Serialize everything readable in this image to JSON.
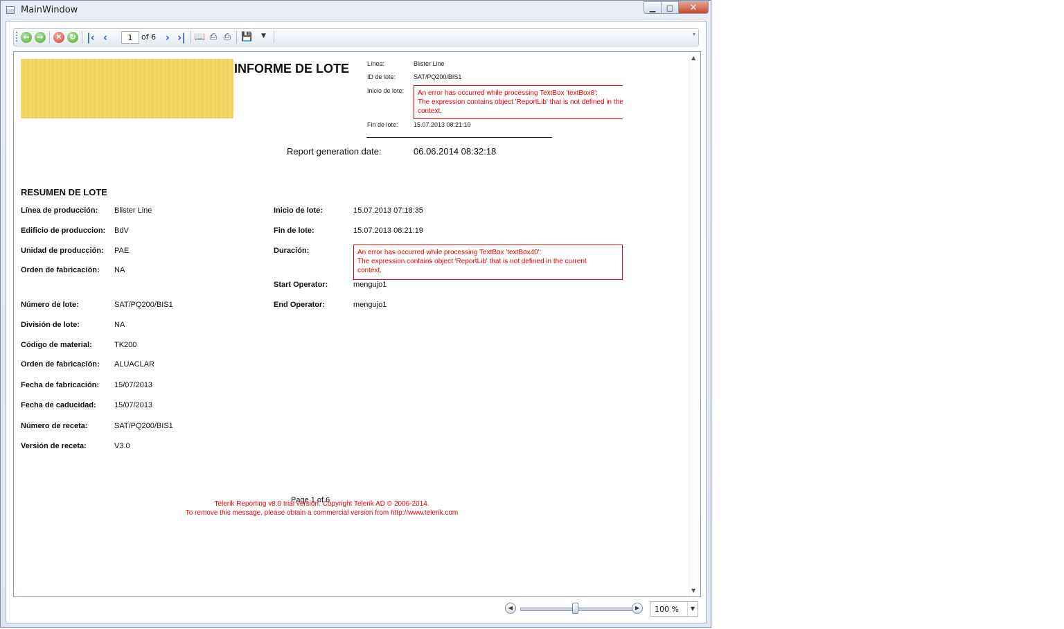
{
  "window": {
    "title": "MainWindow"
  },
  "toolbar": {
    "page_current": "1",
    "page_of": "of 6"
  },
  "report": {
    "title": "INFORME DE LOTE",
    "header": {
      "linea_label": "Línea:",
      "linea_value": "Blister Line",
      "id_label": "ID de lote:",
      "id_value": "SAT/PQ200/BIS1",
      "inicio_label": "Inicio de lote:",
      "inicio_error": [
        "An error has occurred while processing TextBox 'textBox8':",
        "The expression contains object 'ReportLib' that is not defined in the current",
        "context."
      ],
      "fin_label": "Fin de lote:",
      "fin_value": "15.07.2013 08:21:19"
    },
    "generation": {
      "label": "Report generation date:",
      "value": "06.06.2014 08:32:18"
    },
    "summary": {
      "title": "RESUMEN DE LOTE",
      "left_fields": [
        {
          "label": "Línea de producción:",
          "value": "Blister Line"
        },
        {
          "label": "Edificio de produccion:",
          "value": "BdV"
        },
        {
          "label": "Unidad de producción:",
          "value": "PAE"
        },
        {
          "label": "Orden de fabricación:",
          "value": "NA"
        },
        {
          "label": "Número de lote:",
          "value": "SAT/PQ200/BIS1"
        },
        {
          "label": "División de lote:",
          "value": "NA"
        },
        {
          "label": "Código de material:",
          "value": "TK200"
        },
        {
          "label": "Orden de fabricación:",
          "value": "ALUACLAR"
        },
        {
          "label": "Fecha de fabricación:",
          "value": "15/07/2013"
        },
        {
          "label": "Fecha de caducidad:",
          "value": "15/07/2013"
        },
        {
          "label": "Número de receta:",
          "value": "SAT/PQ200/BIS1"
        },
        {
          "label": "Versión de receta:",
          "value": "V3.0"
        }
      ],
      "right_fields": [
        {
          "label": "Inicio de lote:",
          "value": "15.07.2013 07:18:35"
        },
        {
          "label": "Fin de lote:",
          "value": "15.07.2013 08:21:19"
        },
        {
          "label": "Duración:",
          "value": ""
        },
        {
          "label": "Start Operator:",
          "value": "mengujo1"
        },
        {
          "label": "End Operator:",
          "value": "mengujo1"
        }
      ],
      "duracion_error": [
        "An error has occurred while processing TextBox 'textBox40':",
        "The expression contains object 'ReportLib' that is not defined in the current",
        "context."
      ]
    },
    "footer": {
      "page": "Page 1 of 6",
      "trial_line1": "Telerik Reporting v8.0 trial version. Copyright Telerik AD © 2006-2014.",
      "trial_line2": "To remove this message, please obtain a commercial version from http://www.telerik.com"
    }
  },
  "zoom": {
    "value": "100 %"
  },
  "colors": {
    "error": "#ee0000",
    "logo": "#f2d765"
  },
  "icons": [
    "back-icon",
    "forward-icon",
    "stop-icon",
    "refresh-icon",
    "first-page-icon",
    "previous-page-icon",
    "next-page-icon",
    "last-page-icon",
    "print-layout-icon",
    "page-setup-icon",
    "print-icon",
    "save-icon",
    "chevron-down-icon"
  ]
}
